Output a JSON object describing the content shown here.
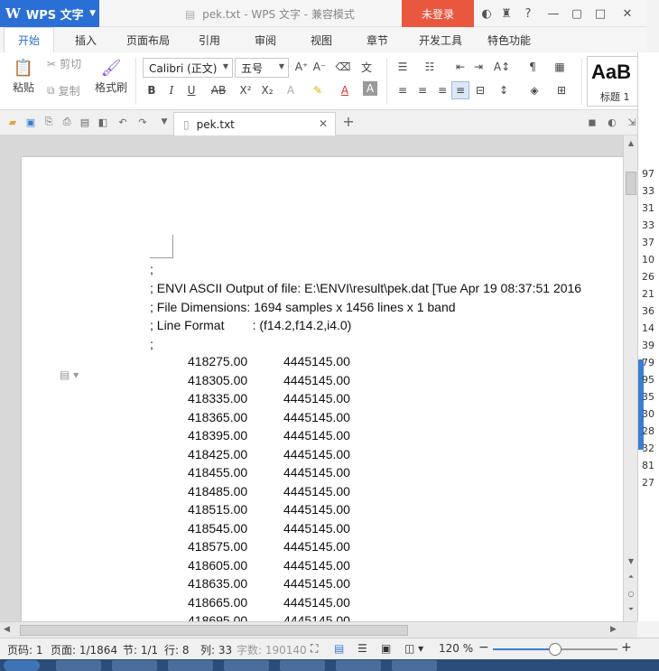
{
  "titlebar": {
    "app_name": "WPS 文字",
    "app_logo": "W",
    "window_title": "pek.txt - WPS 文字 - 兼容模式",
    "login_label": "未登录"
  },
  "tabs": [
    "开始",
    "插入",
    "页面布局",
    "引用",
    "审阅",
    "视图",
    "章节",
    "开发工具",
    "特色功能"
  ],
  "ribbon": {
    "paste_label": "粘贴",
    "cut_label": "剪切",
    "copy_label": "复制",
    "format_painter_label": "格式刷",
    "font_name": "Calibri (正文)",
    "font_size": "五号",
    "style_preview": "AaB",
    "style_label": "标题 1"
  },
  "doc_tab": {
    "name": "pek.txt"
  },
  "document": {
    "header_lines": [
      ";",
      "; ENVI ASCII Output of file: E:\\ENVI\\result\\pek.dat [Tue Apr 19 08:37:51 2016",
      "; File Dimensions: 1694 samples x 1456 lines x 1 band",
      "; Line Format        : (f14.2,f14.2,i4.0)",
      ";"
    ],
    "rows": [
      [
        "418275.00",
        "4445145.00"
      ],
      [
        "418305.00",
        "4445145.00"
      ],
      [
        "418335.00",
        "4445145.00"
      ],
      [
        "418365.00",
        "4445145.00"
      ],
      [
        "418395.00",
        "4445145.00"
      ],
      [
        "418425.00",
        "4445145.00"
      ],
      [
        "418455.00",
        "4445145.00"
      ],
      [
        "418485.00",
        "4445145.00"
      ],
      [
        "418515.00",
        "4445145.00"
      ],
      [
        "418545.00",
        "4445145.00"
      ],
      [
        "418575.00",
        "4445145.00"
      ],
      [
        "418605.00",
        "4445145.00"
      ],
      [
        "418635.00",
        "4445145.00"
      ],
      [
        "418665.00",
        "4445145.00"
      ],
      [
        "418695.00",
        "4445145.00"
      ]
    ]
  },
  "background_app_numbers": [
    "97",
    "33",
    "31",
    "33",
    "37",
    "10",
    "26",
    "21",
    "36",
    "14",
    "39",
    "79",
    "95",
    "35",
    "30",
    "28",
    "32",
    "81",
    "27"
  ],
  "statusbar": {
    "page_code": "页码: 1",
    "page": "页面: 1/1864",
    "section": "节: 1/1",
    "row": "行: 8",
    "col": "列: 33",
    "word_count": "字数: 190140",
    "zoom": "120 %",
    "zoom_fraction": 0.5
  },
  "colors": {
    "accent": "#2a6fd6",
    "login": "#e9573f"
  }
}
